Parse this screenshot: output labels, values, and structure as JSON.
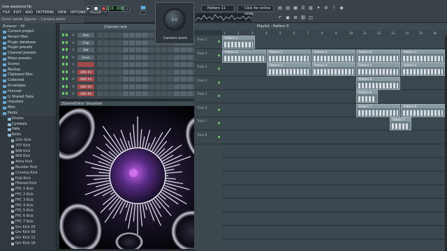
{
  "toolbar": {
    "project_title": "how weekend.flp",
    "menus": [
      "FILE",
      "EDIT",
      "ADD",
      "PATTERNS",
      "VIEW",
      "OPTIONS",
      "TOOLS",
      "?"
    ],
    "hint": "Quick tweak Zgamo :: Camera zoom",
    "bpm": "130.000",
    "pattern": "Pattern 11",
    "online_news": "Click for online news",
    "icons": [
      "play-icon",
      "stop-icon",
      "record-icon",
      "metronome-icon",
      "pattern-icon",
      "song-icon"
    ]
  },
  "camera": {
    "value": "0.0",
    "label": "Camera zoom"
  },
  "browser": {
    "header": "Browser - All",
    "items": [
      {
        "label": "Current project",
        "kind": "section"
      },
      {
        "label": "Recent files",
        "kind": "section"
      },
      {
        "label": "Plugin database",
        "kind": "section"
      },
      {
        "label": "Plugin presets",
        "kind": "section"
      },
      {
        "label": "Channel presets",
        "kind": "section"
      },
      {
        "label": "Mixer presets",
        "kind": "section"
      },
      {
        "label": "Scores",
        "kind": "section"
      },
      {
        "label": "Backup",
        "kind": "section"
      },
      {
        "label": "Clipboard files",
        "kind": "section"
      },
      {
        "label": "Collected",
        "kind": "section"
      },
      {
        "label": "Envelopes",
        "kind": "section"
      },
      {
        "label": "Humner",
        "kind": "section"
      },
      {
        "label": "IL Shared Data",
        "kind": "section"
      },
      {
        "label": "Impulses",
        "kind": "section"
      },
      {
        "label": "Misc",
        "kind": "section"
      },
      {
        "label": "Packs",
        "kind": "section"
      },
      {
        "label": "Drums",
        "kind": "sub"
      },
      {
        "label": "Cymbals",
        "kind": "sub"
      },
      {
        "label": "Hats",
        "kind": "sub"
      },
      {
        "label": "Kicks",
        "kind": "sub"
      },
      {
        "label": "22in Kick",
        "kind": "file"
      },
      {
        "label": "707 Kick",
        "kind": "file"
      },
      {
        "label": "808 Kick",
        "kind": "file"
      },
      {
        "label": "909 Kick",
        "kind": "file"
      },
      {
        "label": "Alina Kick",
        "kind": "file"
      },
      {
        "label": "Boulder Kick",
        "kind": "file"
      },
      {
        "label": "Chroma Kick",
        "kind": "file"
      },
      {
        "label": "Dub Kick",
        "kind": "file"
      },
      {
        "label": "Filtered Kick",
        "kind": "file"
      },
      {
        "label": "FPC 1 Kick",
        "kind": "file"
      },
      {
        "label": "FPC 2 Kick",
        "kind": "file"
      },
      {
        "label": "FPC 3 Kick",
        "kind": "file"
      },
      {
        "label": "FPC 4 Kick",
        "kind": "file"
      },
      {
        "label": "FPC 5 Kick",
        "kind": "file"
      },
      {
        "label": "FPC 6 Kick",
        "kind": "file"
      },
      {
        "label": "FPC 7 Kick",
        "kind": "file"
      },
      {
        "label": "Grv Kick 03",
        "kind": "file"
      },
      {
        "label": "Grv Kick 06",
        "kind": "file"
      },
      {
        "label": "Grv Kick 11",
        "kind": "file"
      },
      {
        "label": "Grv Kick 16",
        "kind": "file"
      }
    ]
  },
  "channel_rack": {
    "title": "Channel rack",
    "channels": [
      {
        "name": "Kick",
        "red": false
      },
      {
        "name": "Clap",
        "red": false
      },
      {
        "name": "Hat",
        "red": false
      },
      {
        "name": "Snare",
        "red": false
      },
      {
        "name": "",
        "red": true
      },
      {
        "name": "GMS #3",
        "red": true
      },
      {
        "name": "GMS #4",
        "red": true
      },
      {
        "name": "GMS #5",
        "red": true
      },
      {
        "name": "GMS #6",
        "red": true
      }
    ]
  },
  "visualizer": {
    "title": "ZGameEditor Visualizer"
  },
  "playlist": {
    "title": "Playlist - Pattern 5",
    "ruler": [
      "1",
      "2",
      "3",
      "4",
      "5",
      "6",
      "7",
      "8",
      "9",
      "10",
      "11",
      "12",
      "13",
      "14",
      "15",
      "16"
    ],
    "tracks": [
      "Track 1",
      "Track 2",
      "Track 3",
      "Track 4",
      "Track 5",
      "Track 6",
      "Track 7",
      "Track 8"
    ],
    "clips": [
      {
        "label": "Pattern 1",
        "track": 0,
        "start": 0,
        "len": 3
      },
      {
        "label": "Pattern 2",
        "track": 1,
        "start": 0,
        "len": 4
      },
      {
        "label": "Pattern 3",
        "track": 1,
        "start": 4,
        "len": 4
      },
      {
        "label": "Pattern 3",
        "track": 1,
        "start": 8,
        "len": 4
      },
      {
        "label": "Pattern 3",
        "track": 1,
        "start": 12,
        "len": 4
      },
      {
        "label": "Pattern 3",
        "track": 1,
        "start": 16,
        "len": 4
      },
      {
        "label": "Pattern 4",
        "track": 2,
        "start": 4,
        "len": 4
      },
      {
        "label": "Pattern 4",
        "track": 2,
        "start": 8,
        "len": 4
      },
      {
        "label": "Pattern 4",
        "track": 2,
        "start": 12,
        "len": 4
      },
      {
        "label": "Pattern 4",
        "track": 2,
        "start": 16,
        "len": 4
      },
      {
        "label": "Pattern 4",
        "track": 3,
        "start": 12,
        "len": 4
      },
      {
        "label": "Pattern 6",
        "track": 4,
        "start": 12,
        "len": 2
      },
      {
        "label": "Pattern 7",
        "track": 5,
        "start": 12,
        "len": 4
      },
      {
        "label": "Pattern 8",
        "track": 5,
        "start": 16,
        "len": 4
      },
      {
        "label": "Pattern 7",
        "track": 6,
        "start": 15,
        "len": 2
      }
    ]
  }
}
